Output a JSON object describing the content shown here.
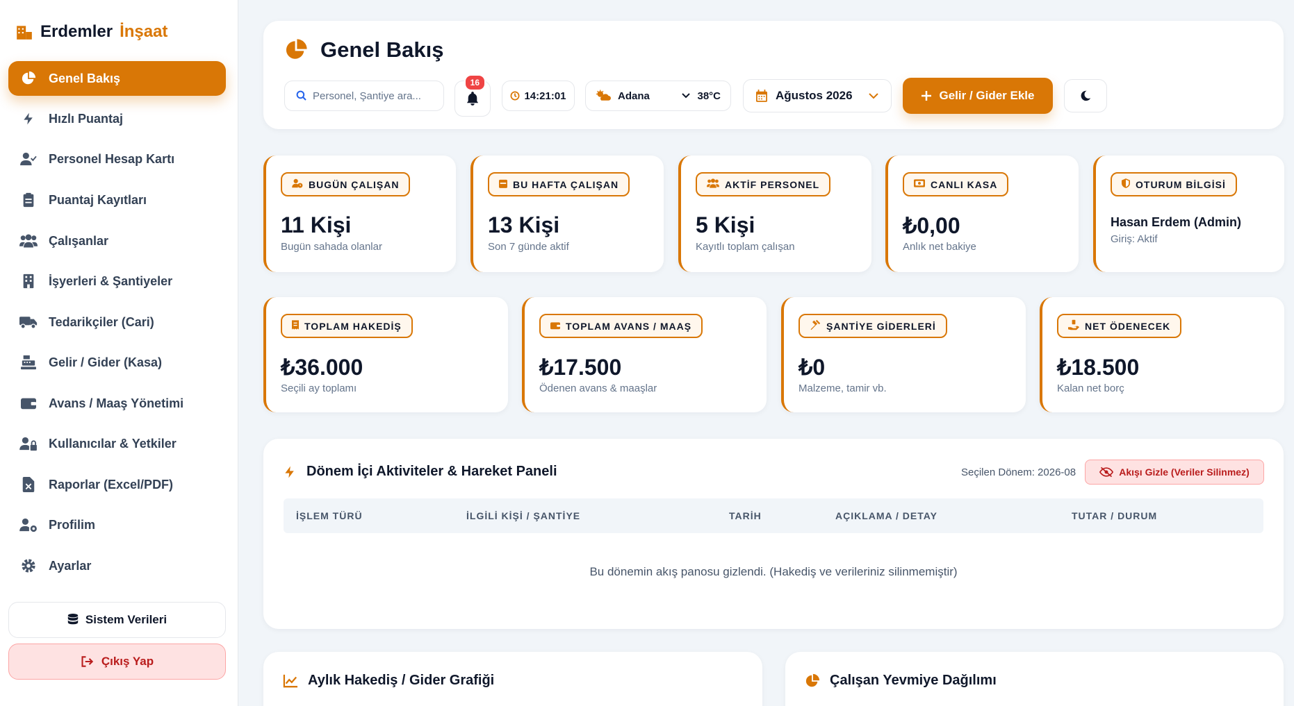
{
  "brand": {
    "name_part1": "Erdemler",
    "name_part2": "İnşaat",
    "icon": "building-icon"
  },
  "sidebar": {
    "items": [
      {
        "label": "Genel Bakış",
        "icon": "pie-chart-icon",
        "active": true
      },
      {
        "label": "Hızlı Puantaj",
        "icon": "bolt-icon"
      },
      {
        "label": "Personel Hesap Kartı",
        "icon": "user-check-icon"
      },
      {
        "label": "Puantaj Kayıtları",
        "icon": "clipboard-icon"
      },
      {
        "label": "Çalışanlar",
        "icon": "users-icon"
      },
      {
        "label": "İşyerleri & Şantiyeler",
        "icon": "building-icon"
      },
      {
        "label": "Tedarikçiler (Cari)",
        "icon": "truck-icon"
      },
      {
        "label": "Gelir / Gider (Kasa)",
        "icon": "cash-register-icon"
      },
      {
        "label": "Avans / Maaş Yönetimi",
        "icon": "wallet-icon"
      },
      {
        "label": "Kullanıcılar & Yetkiler",
        "icon": "user-lock-icon"
      },
      {
        "label": "Raporlar (Excel/PDF)",
        "icon": "file-excel-icon"
      },
      {
        "label": "Profilim",
        "icon": "user-gear-icon"
      },
      {
        "label": "Ayarlar",
        "icon": "gear-icon"
      }
    ],
    "system_data_label": "Sistem Verileri",
    "logout_label": "Çıkış Yap"
  },
  "header": {
    "title": "Genel Bakış",
    "search_placeholder": "Personel, Şantiye ara...",
    "notification_count": "16",
    "clock": "14:21:01",
    "weather_city": "Adana",
    "weather_temp": "38°C",
    "period": "Ağustos 2026",
    "add_button_label": "Gelir / Gider Ekle"
  },
  "stats_row1": [
    {
      "label": "BUGÜN ÇALIŞAN",
      "value": "11 Kişi",
      "sub": "Bugün sahada olanlar",
      "icon": "user-clock-icon"
    },
    {
      "label": "BU HAFTA ÇALIŞAN",
      "value": "13 Kişi",
      "sub": "Son 7 günde aktif",
      "icon": "calendar-week-icon"
    },
    {
      "label": "AKTİF PERSONEL",
      "value": "5 Kişi",
      "sub": "Kayıtlı toplam çalışan",
      "icon": "users-icon"
    },
    {
      "label": "CANLI KASA",
      "value": "₺0,00",
      "sub": "Anlık net bakiye",
      "icon": "money-icon"
    },
    {
      "label": "OTURUM BİLGİSİ",
      "value": "Hasan Erdem (Admin)",
      "sub": "Giriş: Aktif",
      "icon": "shield-icon"
    }
  ],
  "stats_row2": [
    {
      "label": "TOPLAM HAKEDİŞ",
      "value": "₺36.000",
      "sub": "Seçili ay toplamı",
      "icon": "receipt-icon"
    },
    {
      "label": "TOPLAM AVANS / MAAŞ",
      "value": "₺17.500",
      "sub": "Ödenen avans & maaşlar",
      "icon": "wallet-icon"
    },
    {
      "label": "ŞANTİYE GİDERLERİ",
      "value": "₺0",
      "sub": "Malzeme, tamir vb.",
      "icon": "hammer-icon"
    },
    {
      "label": "NET ÖDENECEK",
      "value": "₺18.500",
      "sub": "Kalan net borç",
      "icon": "hand-money-icon"
    }
  ],
  "activity": {
    "title": "Dönem İçi Aktiviteler & Hareket Paneli",
    "period_label": "Seçilen Dönem: 2026-08",
    "hide_button": "Akışı Gizle (Veriler Silinmez)",
    "columns": [
      "İŞLEM TÜRÜ",
      "İLGİLİ KİŞİ / ŞANTİYE",
      "TARİH",
      "AÇIKLAMA / DETAY",
      "TUTAR / DURUM"
    ],
    "empty_message": "Bu dönemin akış panosu gizlendi. (Hakediş ve verileriniz silinmemiştir)"
  },
  "bottom": {
    "chart_title": "Aylık Hakediş / Gider Grafiği",
    "distribution_title": "Çalışan Yevmiye Dağılımı"
  },
  "colors": {
    "accent": "#d97706",
    "danger": "#ef4444"
  }
}
